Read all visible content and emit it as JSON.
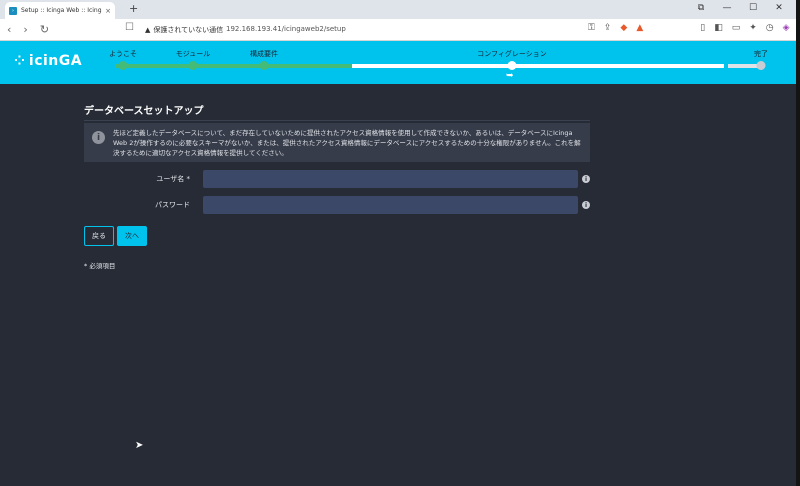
{
  "browser": {
    "tab_title": "Setup :: Icinga Web :: Icinga W...",
    "tab_close": "×",
    "new_tab": "+",
    "security_warning": "保護されていない通信",
    "url": "192.168.193.41/icingaweb2/setup",
    "window_buttons": [
      "⧉",
      "—",
      "☐",
      "✕"
    ]
  },
  "header": {
    "logo_text": "icinGA",
    "steps": [
      {
        "label": "ようこそ",
        "state": "done"
      },
      {
        "label": "モジュール",
        "state": "done"
      },
      {
        "label": "構成要件",
        "state": "done"
      },
      {
        "label": "コンフィグレーション",
        "state": "current"
      },
      {
        "label": "完了",
        "state": "todo"
      }
    ],
    "colors": {
      "brand": "#00c3ed",
      "done": "#44bb77",
      "background": "#262b36"
    }
  },
  "page": {
    "title": "データベースセットアップ",
    "note_text": "先ほど定義したデータベースについて、まだ存在していないために提供されたアクセス資格情報を使用して作成できないか、あるいは、データベースにIcinga Web 2が操作するのに必要なスキーマがないか、または、提供されたアクセス資格情報にデータベースにアクセスするための十分な権限がありません。これを解決するために適切なアクセス資格情報を提供してください。",
    "username_label": "ユーザ名 *",
    "username_value": "",
    "password_label": "パスワード",
    "password_value": "",
    "back_label": "戻る",
    "next_label": "次へ",
    "required_note": "* 必須項目"
  }
}
